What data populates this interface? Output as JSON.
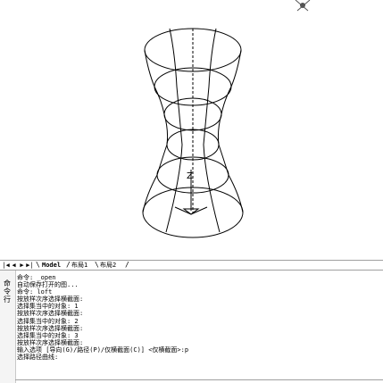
{
  "tabs": {
    "nav": [
      "|◀",
      "◀",
      "▶",
      "▶|"
    ],
    "items": [
      {
        "label": "Model",
        "active": true
      },
      {
        "label": "布局1",
        "active": false
      },
      {
        "label": "布局2",
        "active": false
      }
    ]
  },
  "command": {
    "side_label": "命令行",
    "lines": [
      "命令: _open",
      "自动保存打开的图...",
      "命令: loft",
      "按放样次序选择横截面:",
      "选择集当中的对象: 1",
      "按放样次序选择横截面:",
      "选择集当中的对象: 2",
      "按放样次序选择横截面:",
      "选择集当中的对象: 3",
      "按放样次序选择横截面:",
      "输入选项 [导向(G)/路径(P)/仅横截面(C)] <仅横截面>:p",
      "选择路径曲线:"
    ]
  },
  "drawing": {
    "ucs_label": "Z",
    "line_color": "#000000",
    "background": "#ffffff"
  }
}
